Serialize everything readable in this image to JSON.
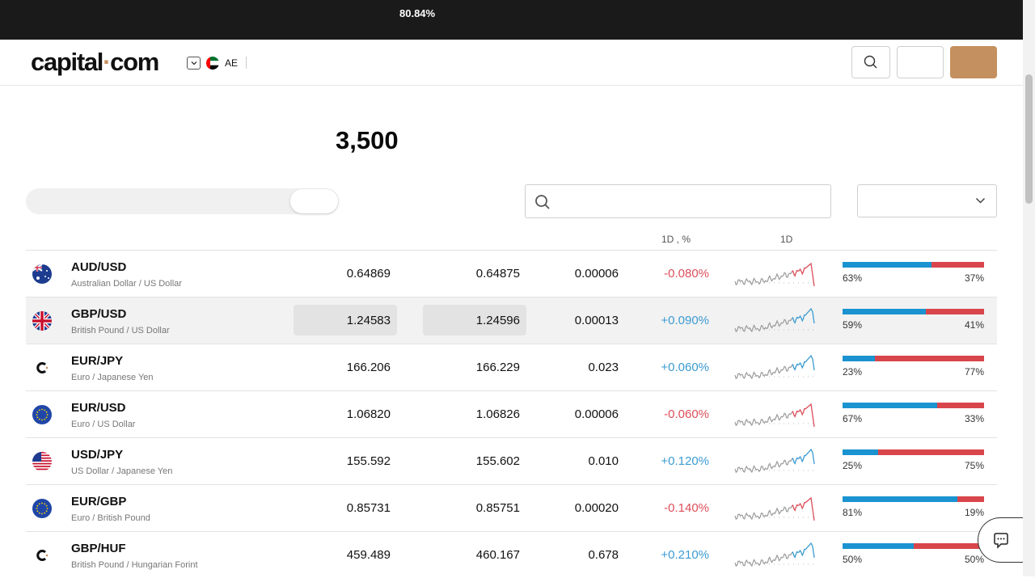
{
  "topbar": {
    "percentage": "80.84%"
  },
  "header": {
    "logo": {
      "part1": "capital",
      "dot": "·",
      "part2": "com"
    },
    "region_code": "AE"
  },
  "hero": {
    "count": "3,500"
  },
  "table": {
    "headers": {
      "change": "1D      , %",
      "chart": "1D"
    },
    "rows": [
      {
        "symbol": "AUD/USD",
        "description": "Australian Dollar / US Dollar",
        "sell": "0.64869",
        "buy": "0.64875",
        "spread": "0.00006",
        "change": "-0.080%",
        "direction": "neg",
        "buyers_pct": 63,
        "buyers": "63%",
        "sellers": "37%",
        "flag": "au-flag",
        "spark_end": "down"
      },
      {
        "symbol": "GBP/USD",
        "description": "British Pound / US Dollar",
        "sell": "1.24583",
        "buy": "1.24596",
        "spread": "0.00013",
        "change": "+0.090%",
        "direction": "pos",
        "buyers_pct": 59,
        "buyers": "59%",
        "sellers": "41%",
        "flag": "gb-flag",
        "spark_end": "up"
      },
      {
        "symbol": "EUR/JPY",
        "description": "Euro / Japanese Yen",
        "sell": "166.206",
        "buy": "166.229",
        "spread": "0.023",
        "change": "+0.060%",
        "direction": "pos",
        "buyers_pct": 23,
        "buyers": "23%",
        "sellers": "77%",
        "flag": "capital-logo-icon",
        "spark_end": "up"
      },
      {
        "symbol": "EUR/USD",
        "description": "Euro / US Dollar",
        "sell": "1.06820",
        "buy": "1.06826",
        "spread": "0.00006",
        "change": "-0.060%",
        "direction": "neg",
        "buyers_pct": 67,
        "buyers": "67%",
        "sellers": "33%",
        "flag": "eu-flag",
        "spark_end": "down"
      },
      {
        "symbol": "USD/JPY",
        "description": "US Dollar / Japanese Yen",
        "sell": "155.592",
        "buy": "155.602",
        "spread": "0.010",
        "change": "+0.120%",
        "direction": "pos",
        "buyers_pct": 25,
        "buyers": "25%",
        "sellers": "75%",
        "flag": "us-flag",
        "spark_end": "up"
      },
      {
        "symbol": "EUR/GBP",
        "description": "Euro / British Pound",
        "sell": "0.85731",
        "buy": "0.85751",
        "spread": "0.00020",
        "change": "-0.140%",
        "direction": "neg",
        "buyers_pct": 81,
        "buyers": "81%",
        "sellers": "19%",
        "flag": "eu-flag",
        "spark_end": "down"
      },
      {
        "symbol": "GBP/HUF",
        "description": "British Pound / Hungarian Forint",
        "sell": "459.489",
        "buy": "460.167",
        "spread": "0.678",
        "change": "+0.210%",
        "direction": "pos",
        "buyers_pct": 50,
        "buyers": "50%",
        "sellers": "50%",
        "flag": "capital-logo-icon",
        "spark_end": "up"
      }
    ]
  },
  "colors": {
    "accent": "#c4905f",
    "buy_blue": "#1b93d0",
    "sell_red": "#d8454b",
    "positive": "#3b9bd1",
    "negative": "#dc4f5a"
  }
}
